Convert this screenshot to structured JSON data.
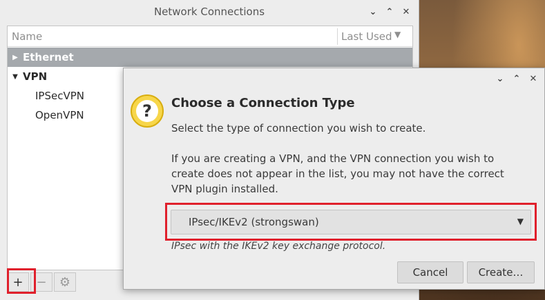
{
  "main_window": {
    "title": "Network Connections",
    "list": {
      "columns": [
        "Name",
        "Last Used"
      ],
      "groups": [
        {
          "label": "Ethernet",
          "expanded": false,
          "items": []
        },
        {
          "label": "VPN",
          "expanded": true,
          "items": [
            "IPSecVPN",
            "OpenVPN"
          ]
        }
      ]
    },
    "toolbar": {
      "add": "+",
      "remove": "−"
    }
  },
  "dialog": {
    "heading": "Choose a Connection Type",
    "subtitle": "Select the type of connection you wish to create.",
    "info": "If you are creating a VPN, and the VPN connection you wish to create does not appear in the list, you may not have the correct VPN plugin installed.",
    "select": {
      "value": "IPsec/IKEv2 (strongswan)",
      "description": "IPsec with the IKEv2 key exchange protocol."
    },
    "buttons": {
      "cancel": "Cancel",
      "create": "Create…"
    }
  },
  "colors": {
    "highlight": "#e0202c",
    "selected_row": "#a5a9ad",
    "question_icon": "#f7d64a"
  },
  "icons": {
    "window_controls": [
      "chevron-down-icon",
      "chevron-up-icon",
      "close-icon"
    ],
    "settings": "gear-icon",
    "dialog_icon": "question-icon"
  }
}
